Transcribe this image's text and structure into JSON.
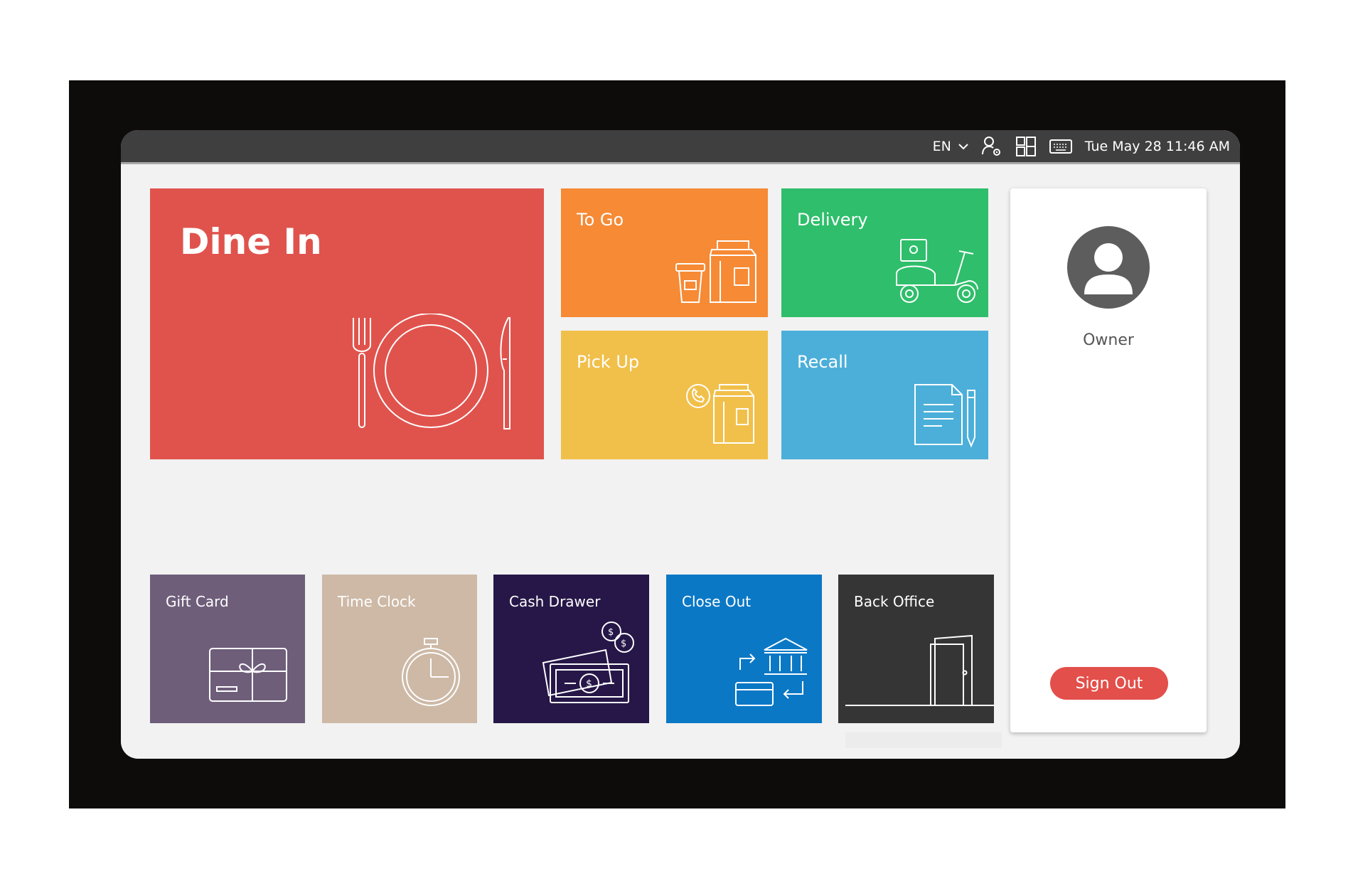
{
  "topbar": {
    "language": "EN",
    "datetime": "Tue May 28 11:46 AM",
    "icons": [
      "chevron-down-icon",
      "user-settings-icon",
      "layout-icon",
      "keyboard-icon"
    ]
  },
  "main_tiles": {
    "dine_in": "Dine In",
    "to_go": "To Go",
    "delivery": "Delivery",
    "pick_up": "Pick Up",
    "recall": "Recall"
  },
  "small_tiles": {
    "gift_card": "Gift Card",
    "time_clock": "Time Clock",
    "cash_drawer": "Cash Drawer",
    "close_out": "Close Out",
    "back_office": "Back Office"
  },
  "profile": {
    "user_name": "Owner",
    "sign_out_label": "Sign Out"
  },
  "colors": {
    "dine_in": "#e0534d",
    "to_go": "#f68a35",
    "delivery": "#2fbe6b",
    "pick_up": "#f1c04b",
    "recall": "#4cafd9",
    "gift_card": "#6e5e7a",
    "time_clock": "#cdb9a6",
    "cash_drawer": "#261748",
    "close_out": "#0b78c5",
    "back_office": "#353535",
    "sign_out": "#e34f4a"
  }
}
